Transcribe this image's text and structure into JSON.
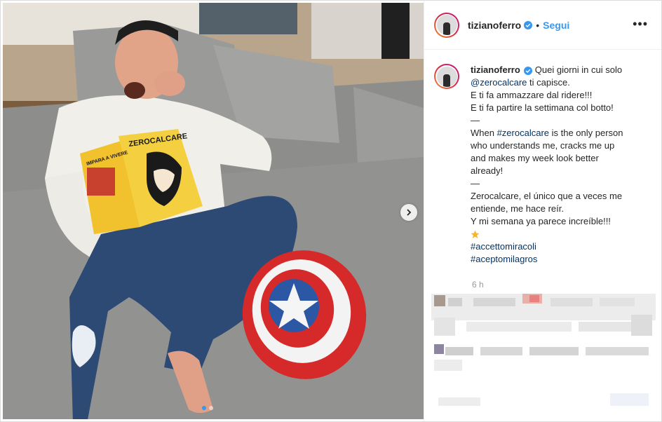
{
  "post": {
    "username": "tizianoferro",
    "follow_label": "Segui",
    "separator": "•",
    "more_label": "•••",
    "caption_lines": [
      "Quei giorni in cui solo",
      "@zerocalcare",
      " ti capisce.",
      "E ti fa ammazzare dal ridere!!!",
      "E ti fa partire la settimana col botto!",
      "—",
      "When ",
      "#zerocalcare",
      " is the only person",
      "who understands me, cracks me up",
      "and makes my week look better",
      "already!",
      "—",
      "Zerocalcare, el único que a veces me",
      "entiende, me hace reír.",
      "Y mi semana ya parece increíble!!!",
      "#accettomiracoli",
      "#aceptomilagros"
    ],
    "time": "6 h"
  },
  "photo": {
    "book_title": "ZEROCALCARE",
    "book_spine": "IMPARA A VIVERE",
    "icon": "image-photo"
  },
  "colors": {
    "link": "#003569",
    "follow": "#3897f0",
    "verified": "#3897f0"
  }
}
